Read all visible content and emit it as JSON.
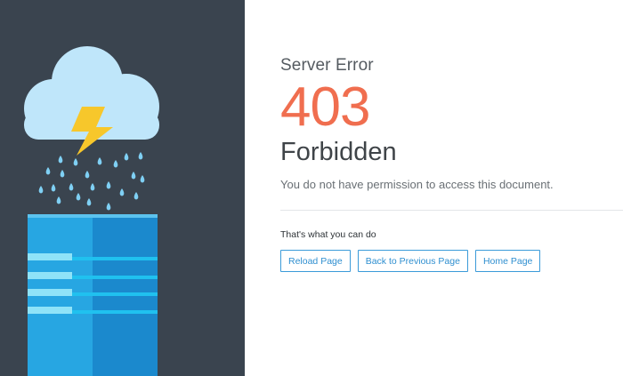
{
  "error": {
    "eyebrow": "Server Error",
    "code": "403",
    "status": "Forbidden",
    "message": "You do not have permission to access this document."
  },
  "actions": {
    "heading": "That's what you can do",
    "buttons": [
      {
        "label": "Reload Page"
      },
      {
        "label": "Back to Previous Page"
      },
      {
        "label": "Home Page"
      }
    ]
  },
  "illustration": {
    "icons": [
      "cloud-icon",
      "lightning-bolt-icon",
      "raindrop-icon",
      "server-icon"
    ]
  },
  "colors": {
    "left_panel": "#3a444f",
    "code_accent": "#f06e4f",
    "button_border": "#3b9bd9",
    "cloud": "#bfe6fa",
    "bolt": "#f7c72b",
    "server_light": "#27a6e2",
    "server_dark": "#1b89cd"
  }
}
